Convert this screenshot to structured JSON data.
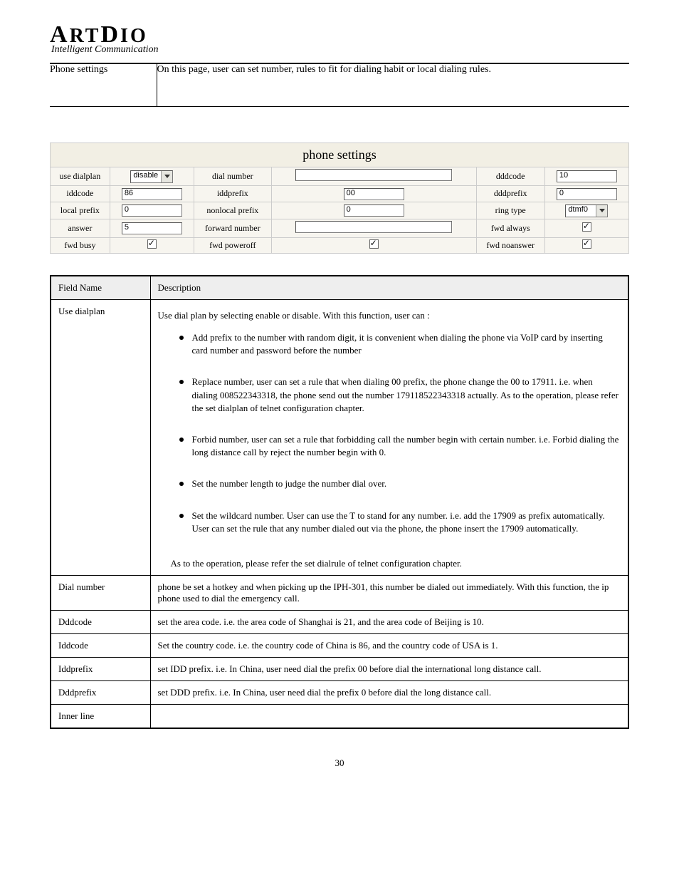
{
  "logo": {
    "brand": "ArtDio",
    "tagline": "Intelligent Communication"
  },
  "header": {
    "left": "Phone settings",
    "right": "On this page, user can set number, rules to fit for dialing habit or local dialing rules."
  },
  "screenshot": {
    "title": "phone settings",
    "rows": [
      {
        "c1": "use dialplan",
        "v1": {
          "type": "select",
          "value": "disable"
        },
        "c2": "dial number",
        "v2": {
          "type": "text",
          "value": "",
          "wide": true
        },
        "c3": "dddcode",
        "v3": {
          "type": "text",
          "value": "10"
        }
      },
      {
        "c1": "iddcode",
        "v1": {
          "type": "text",
          "value": "86"
        },
        "c2": "iddprefix",
        "v2": {
          "type": "text",
          "value": "00"
        },
        "c3": "dddprefix",
        "v3": {
          "type": "text",
          "value": "0"
        }
      },
      {
        "c1": "local prefix",
        "v1": {
          "type": "text",
          "value": "0"
        },
        "c2": "nonlocal prefix",
        "v2": {
          "type": "text",
          "value": "0"
        },
        "c3": "ring type",
        "v3": {
          "type": "select",
          "value": "dtmf0"
        }
      },
      {
        "c1": "answer",
        "v1": {
          "type": "text",
          "value": "5"
        },
        "c2": "forward number",
        "v2": {
          "type": "text",
          "value": "",
          "wide": true
        },
        "c3": "fwd always",
        "v3": {
          "type": "check"
        }
      },
      {
        "c1": "fwd busy",
        "v1": {
          "type": "check"
        },
        "c2": "fwd poweroff",
        "v2": {
          "type": "check"
        },
        "c3": "fwd noanswer",
        "v3": {
          "type": "check"
        }
      }
    ]
  },
  "ref": {
    "head": {
      "field": "Field Name",
      "desc": "Description"
    },
    "rows": [
      {
        "field": "Use dialplan",
        "type": "list",
        "intro": "Use dial plan by selecting enable or disable. With this function, user can :",
        "items": [
          "Add prefix to the number with random digit, it is convenient when dialing the phone via VoIP card by inserting card number and password before the number",
          "Replace number, user can set a rule that when dialing 00 prefix, the phone change the 00 to 17911. i.e. when dialing 008522343318, the phone send out the number 179118522343318 actually. As to the operation, please refer the set dialplan of telnet configuration chapter.",
          "Forbid number, user can set a rule that forbidding call the number begin with certain number. i.e. Forbid dialing the long distance call by reject the number begin with 0.",
          "Set the number length to judge the number dial over.",
          "Set the wildcard number. User can use the T to stand for any number. i.e. add the 17909 as prefix automatically. User can set the rule that any number dialed out via the phone, the phone insert the 17909 automatically."
        ],
        "ringNote": "As to the operation, please refer the set dialrule of telnet configuration chapter."
      },
      {
        "field": "Dial number",
        "type": "cell",
        "value": "phone be set a hotkey and when picking up the IPH-301, this number be dialed out immediately. With this function, the ip phone used to dial the emergency call."
      },
      {
        "field": "Dddcode",
        "type": "cell",
        "value": "set the area code. i.e. the area code of Shanghai is 21, and the area code of Beijing is 10."
      },
      {
        "field": "Iddcode",
        "type": "cell",
        "value": "Set the country code. i.e. the country code of China is 86, and the country code of USA is 1."
      },
      {
        "field": "Iddprefix",
        "type": "cell",
        "value": "set IDD prefix. i.e. In China, user need dial the prefix 00 before dial the international long distance call."
      },
      {
        "field": "Dddprefix",
        "type": "cell",
        "value": "set DDD prefix. i.e. In China, user need dial the prefix 0 before dial the long distance call."
      },
      {
        "field": "Inner line",
        "type": "cell",
        "value": ""
      }
    ]
  },
  "pagenum": "30"
}
